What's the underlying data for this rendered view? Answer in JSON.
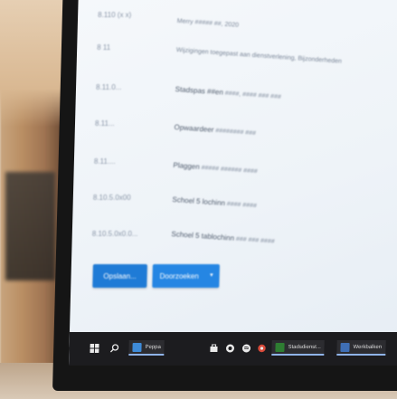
{
  "form": {
    "rows": [
      {
        "label": "8.110 (x x)",
        "value_strong": "",
        "value": "Merry ##### ##, 2020"
      },
      {
        "label": "8 11",
        "value_strong": "",
        "value": "Wijzigingen toegepast aan dienstverlening, Bijzonderheden"
      },
      {
        "label": "8.11.0...",
        "value_strong": "Stadspas ##en",
        "value": "####, ####  ### ###"
      },
      {
        "label": "8.11...",
        "value_strong": "Opwaardeer",
        "value": "######## ###"
      },
      {
        "label": "8.11....",
        "value_strong": "Plaggen",
        "value": "##### ######  ####"
      },
      {
        "label": "8.10.5.0x00",
        "value_strong": "Schoel 5 lochinn",
        "value": "####  ####"
      },
      {
        "label": "8.10.5.0x0.0...",
        "value_strong": "Schoel 5 tablochinn",
        "value": "### ### ####"
      }
    ],
    "buttons": {
      "primary_label": "Opslaan...",
      "split_label": "Doorzoeken"
    }
  },
  "taskbar": {
    "icons": [
      "windows-icon",
      "search-icon",
      "file-explorer-icon",
      "store-icon",
      "chrome-icon",
      "spotify-icon",
      "settings-icon"
    ],
    "apps": [
      {
        "label": "Peppa"
      },
      {
        "label": "Stadsdienst..."
      },
      {
        "label": "Werkbalken"
      }
    ]
  },
  "colors": {
    "primary_button": "#1f7bd6",
    "secondary_button": "#2586e3",
    "taskbar": "#1c1c1f",
    "screen_bg": "#eef3f8"
  }
}
